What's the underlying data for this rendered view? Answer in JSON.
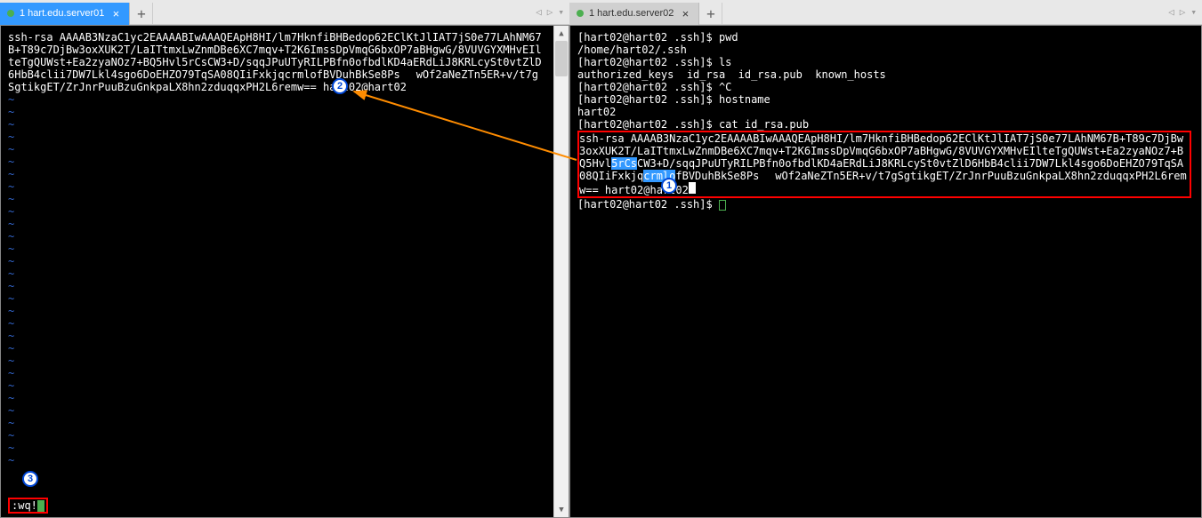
{
  "tabs": {
    "left": {
      "label": "1 hart.edu.server01"
    },
    "right": {
      "label": "1 hart.edu.server02"
    }
  },
  "left_terminal": {
    "ssh_key": "ssh-rsa AAAAB3NzaC1yc2EAAAABIwAAAQEApH8HI/lm7HknfiBHBedop62EClKtJlIAT7jS0e77LAhNM67B+T89c7DjBw3oxXUK2T/LaITtmxLwZnmDBe6XC7mqv+T2K6ImssDpVmqG6bxOP7aBHgwG/8VUVGYXMHvEIlteTgQUWst+Ea2zyaNOz7+BQ5Hvl5rCsCW3+D/sqqJPuUTyRILPBfn0ofbdlKD4aERdLiJ8KRLcySt0vtZlD6HbB4clii7DW7Lkl4sgo6DoEHZO79TqSA08QIiFxkjqcrmlofBVDuhBkSe8Ps",
    "ssh_key_after": "wOf2aNeZTn5ER+v/t7gSgtikgET/ZrJnrPuuBzuGnkpaLX8hn2zduqqxPH2L6remw== hart02@hart02",
    "vi_status": ":wq!"
  },
  "right_terminal": {
    "lines": [
      "[hart02@hart02 .ssh]$ pwd",
      "/home/hart02/.ssh",
      "[hart02@hart02 .ssh]$ ls",
      "authorized_keys  id_rsa  id_rsa.pub  known_hosts",
      "[hart02@hart02 .ssh]$ ^C",
      "[hart02@hart02 .ssh]$ hostname",
      "hart02",
      "[hart02@hart02 .ssh]$ cat id_rsa.pub"
    ],
    "ssh_key_p1": "ssh-rsa AAAAB3NzaC1yc2EAAAABIwAAAQEApH8HI/lm7HknfiBHBedop62EClKtJlIAT7jS0e77LAhNM67B+T89c7DjBw3oxXUK2T/LaITtmxLwZnmDBe6XC7mqv+T2K6ImssDpVmqG6bxOP7aBHgwG/8VUVGYXMHvEIlteTgQUWst+Ea2zyaNOz7+BQ5Hvl",
    "ssh_key_hl": "5rCs",
    "ssh_key_p2": "CW3+D/sqqJPuUTyRILPBfn0ofbdlKD4aERdLiJ8KRLcySt0vtZlD6HbB4clii7DW7Lkl4sgo6DoEHZO79TqSA08QIiFxkjq",
    "ssh_key_hl2": "crmlo",
    "ssh_key_p3": "fBVDuhBkSe8Ps",
    "ssh_key_p4": "wOf2aNeZTn5ER+v/t7gSgtikgET/ZrJnrPuuBzuGnkpaLX8hn2zduqqxPH2L6remw== hart02@hart02",
    "prompt_after": "[hart02@hart02 .ssh]$ "
  },
  "callouts": {
    "c1": "1",
    "c2": "2",
    "c3": "3"
  }
}
